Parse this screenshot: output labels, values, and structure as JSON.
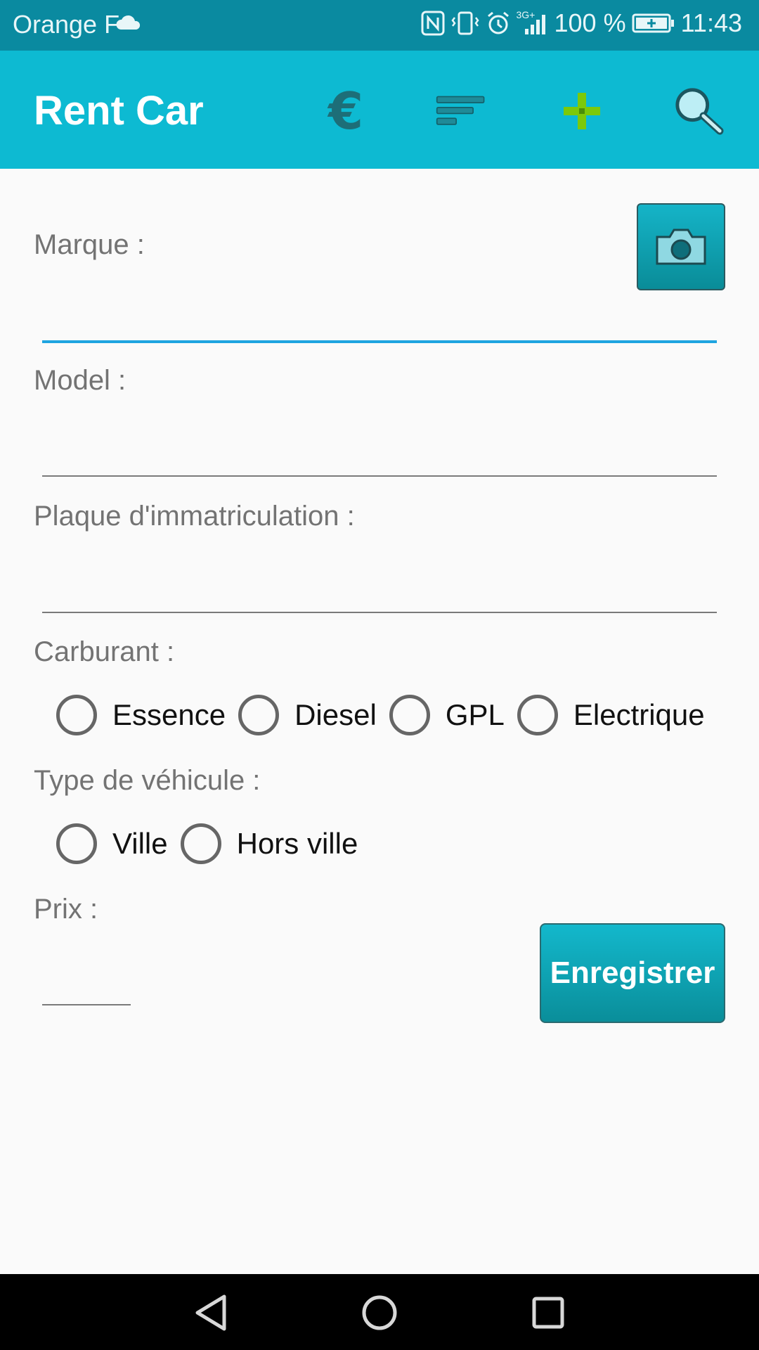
{
  "status_bar": {
    "carrier": "Orange F",
    "battery": "100 %",
    "time": "11:43",
    "network": "3G+",
    "icons": [
      "cloud-icon",
      "nfc-icon",
      "vibrate-icon",
      "alarm-icon",
      "signal-icon",
      "battery-charging-icon"
    ]
  },
  "toolbar": {
    "title": "Rent Car",
    "actions": [
      "euro-icon",
      "sort-icon",
      "add-icon",
      "search-icon"
    ],
    "colors": {
      "background": "#0dbad2",
      "add_icon": "#7cc90a"
    }
  },
  "form": {
    "brand": {
      "label": "Marque :",
      "value": "",
      "focused": true
    },
    "model": {
      "label": "Model :",
      "value": ""
    },
    "plate": {
      "label": "Plaque d'immatriculation :",
      "value": ""
    },
    "fuel": {
      "label": "Carburant :",
      "options": [
        "Essence",
        "Diesel",
        "GPL",
        "Electrique"
      ],
      "selected": null
    },
    "vehicle_type": {
      "label": "Type de véhicule :",
      "options": [
        "Ville",
        "Hors ville"
      ],
      "selected": null
    },
    "price": {
      "label": "Prix :",
      "value": ""
    },
    "camera_button": "camera-icon",
    "save_label": "Enregistrer"
  },
  "nav_bar": [
    "back-icon",
    "home-icon",
    "recent-apps-icon"
  ]
}
